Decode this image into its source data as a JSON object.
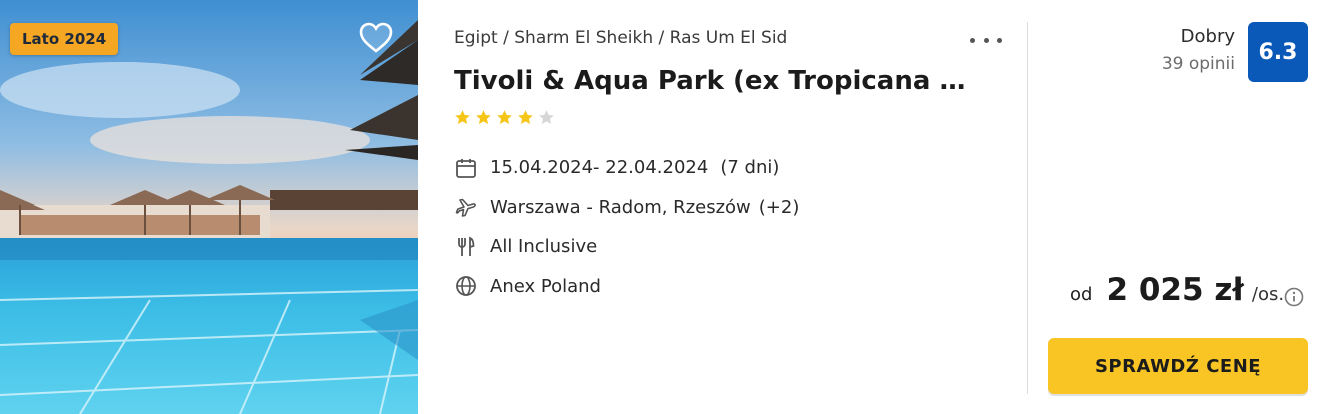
{
  "badge": {
    "season": "Lato 2024"
  },
  "hotel": {
    "breadcrumb": "Egipt / Sharm El Sheikh / Ras Um El Sid",
    "name": "Tivoli & Aqua Park (ex Tropicana Tiv…",
    "stars": 4,
    "stars_max": 5
  },
  "details": {
    "dates": "15.04.2024- 22.04.2024",
    "duration": "(7 dni)",
    "departure": "Warszawa - Radom, Rzeszów",
    "departure_extra": "(+2)",
    "board": "All Inclusive",
    "operator": "Anex Poland"
  },
  "rating": {
    "label": "Dobry",
    "reviews": "39 opinii",
    "score": "6.3"
  },
  "price": {
    "from": "od",
    "value": "2 025 zł",
    "unit": "/os."
  },
  "cta": {
    "label": "SPRAWDŹ CENĘ"
  },
  "colors": {
    "badge": "#f5a623",
    "score": "#0a58b8",
    "star": "#f5c518",
    "star_empty": "#d6d6d6",
    "cta": "#f8c525"
  },
  "icons": {
    "favorite": "heart-icon",
    "more": "more-icon",
    "dates": "calendar-icon",
    "departure": "plane-icon",
    "board": "cutlery-icon",
    "operator": "globe-icon",
    "price_info": "info-icon"
  }
}
